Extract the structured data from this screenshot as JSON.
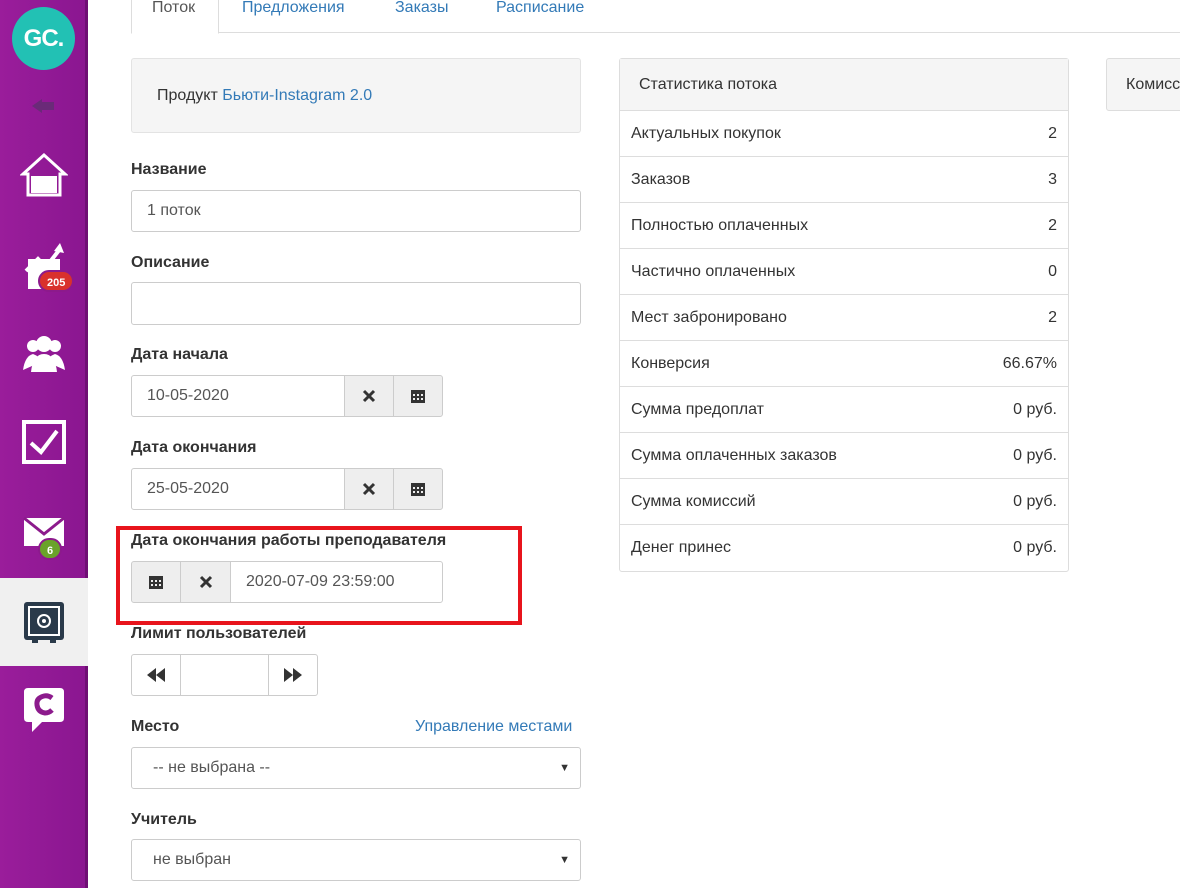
{
  "sidebar": {
    "logo_text": "GC.",
    "badges": {
      "sales": "205",
      "messages": "6"
    },
    "icons": [
      "collapse-icon",
      "home-icon",
      "chart-icon",
      "users-icon",
      "checkbox-icon",
      "mail-icon",
      "safe-icon",
      "chat-icon"
    ]
  },
  "tabs": [
    {
      "label": "Поток"
    },
    {
      "label": "Предложения"
    },
    {
      "label": "Заказы"
    },
    {
      "label": "Расписание"
    }
  ],
  "product": {
    "prefix": "Продукт",
    "link": "Бьюти-Instagram 2.0"
  },
  "form": {
    "name_label": "Название",
    "name_value": "1 поток",
    "description_label": "Описание",
    "description_value": "",
    "start_label": "Дата начала",
    "start_value": "10-05-2020",
    "end_label": "Дата окончания",
    "end_value": "25-05-2020",
    "teacher_end_label": "Дата окончания работы преподавателя",
    "teacher_end_value": "2020-07-09 23:59:00",
    "limit_label": "Лимит пользователей",
    "limit_value": "",
    "place_label": "Место",
    "place_manage_link": "Управление местами",
    "place_value": "-- не выбрана --",
    "teacher_label": "Учитель",
    "teacher_value": "не выбран"
  },
  "stats": {
    "title": "Статистика потока",
    "rows": [
      {
        "label": "Актуальных покупок",
        "value": "2"
      },
      {
        "label": "Заказов",
        "value": "3"
      },
      {
        "label": "Полностью оплаченных",
        "value": "2"
      },
      {
        "label": "Частично оплаченных",
        "value": "0"
      },
      {
        "label": "Мест забронировано",
        "value": "2"
      },
      {
        "label": "Конверсия",
        "value": "66.67%"
      },
      {
        "label": "Сумма предоплат",
        "value": "0 руб."
      },
      {
        "label": "Сумма оплаченных заказов",
        "value": "0 руб."
      },
      {
        "label": "Сумма комиссий",
        "value": "0 руб."
      },
      {
        "label": "Денег принес",
        "value": "0 руб."
      }
    ]
  },
  "commission_panel": {
    "title": "Комисс"
  },
  "colors": {
    "sidebar": "#8c1a8c",
    "logo": "#22c1b4",
    "link": "#337ab7",
    "highlight": "#e8141c"
  }
}
